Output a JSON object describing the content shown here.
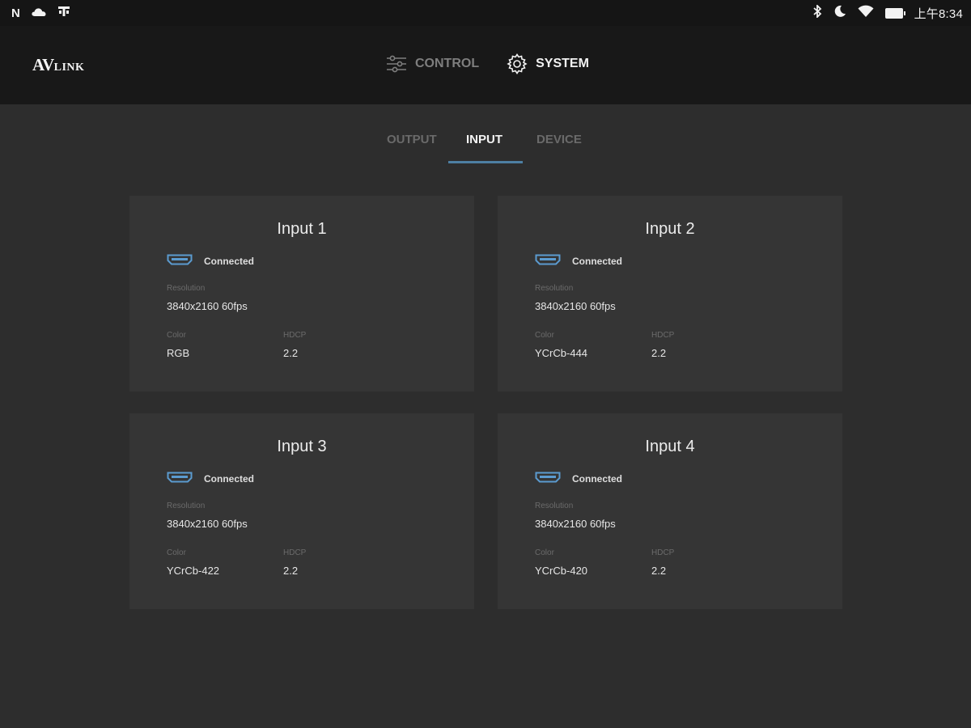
{
  "status_bar": {
    "left_icons": [
      "n-icon",
      "cloud-icon",
      "notification-icon"
    ],
    "right_icons": [
      "bluetooth-icon",
      "moon-icon",
      "wifi-icon",
      "battery-icon"
    ],
    "time": "上午8:34"
  },
  "app": {
    "logo_main": "AV",
    "logo_sub": "LINK",
    "nav": [
      {
        "label": "CONTROL",
        "icon": "sliders-icon",
        "active": false
      },
      {
        "label": "SYSTEM",
        "icon": "gear-icon",
        "active": true
      }
    ]
  },
  "tabs": [
    {
      "label": "OUTPUT",
      "active": false
    },
    {
      "label": "INPUT",
      "active": true
    },
    {
      "label": "DEVICE",
      "active": false
    }
  ],
  "colors": {
    "accent": "#4d7fa3",
    "background": "#2d2d2d",
    "card": "#353535",
    "appbar": "#181818"
  },
  "inputs": [
    {
      "title": "Input 1",
      "status": "Connected",
      "resolution_label": "Resolution",
      "resolution": "3840x2160 60fps",
      "color_label": "Color",
      "color": "RGB",
      "hdcp_label": "HDCP",
      "hdcp": "2.2"
    },
    {
      "title": "Input 2",
      "status": "Connected",
      "resolution_label": "Resolution",
      "resolution": "3840x2160 60fps",
      "color_label": "Color",
      "color": "YCrCb-444",
      "hdcp_label": "HDCP",
      "hdcp": "2.2"
    },
    {
      "title": "Input 3",
      "status": "Connected",
      "resolution_label": "Resolution",
      "resolution": "3840x2160 60fps",
      "color_label": "Color",
      "color": "YCrCb-422",
      "hdcp_label": "HDCP",
      "hdcp": "2.2"
    },
    {
      "title": "Input 4",
      "status": "Connected",
      "resolution_label": "Resolution",
      "resolution": "3840x2160 60fps",
      "color_label": "Color",
      "color": "YCrCb-420",
      "hdcp_label": "HDCP",
      "hdcp": "2.2"
    }
  ]
}
